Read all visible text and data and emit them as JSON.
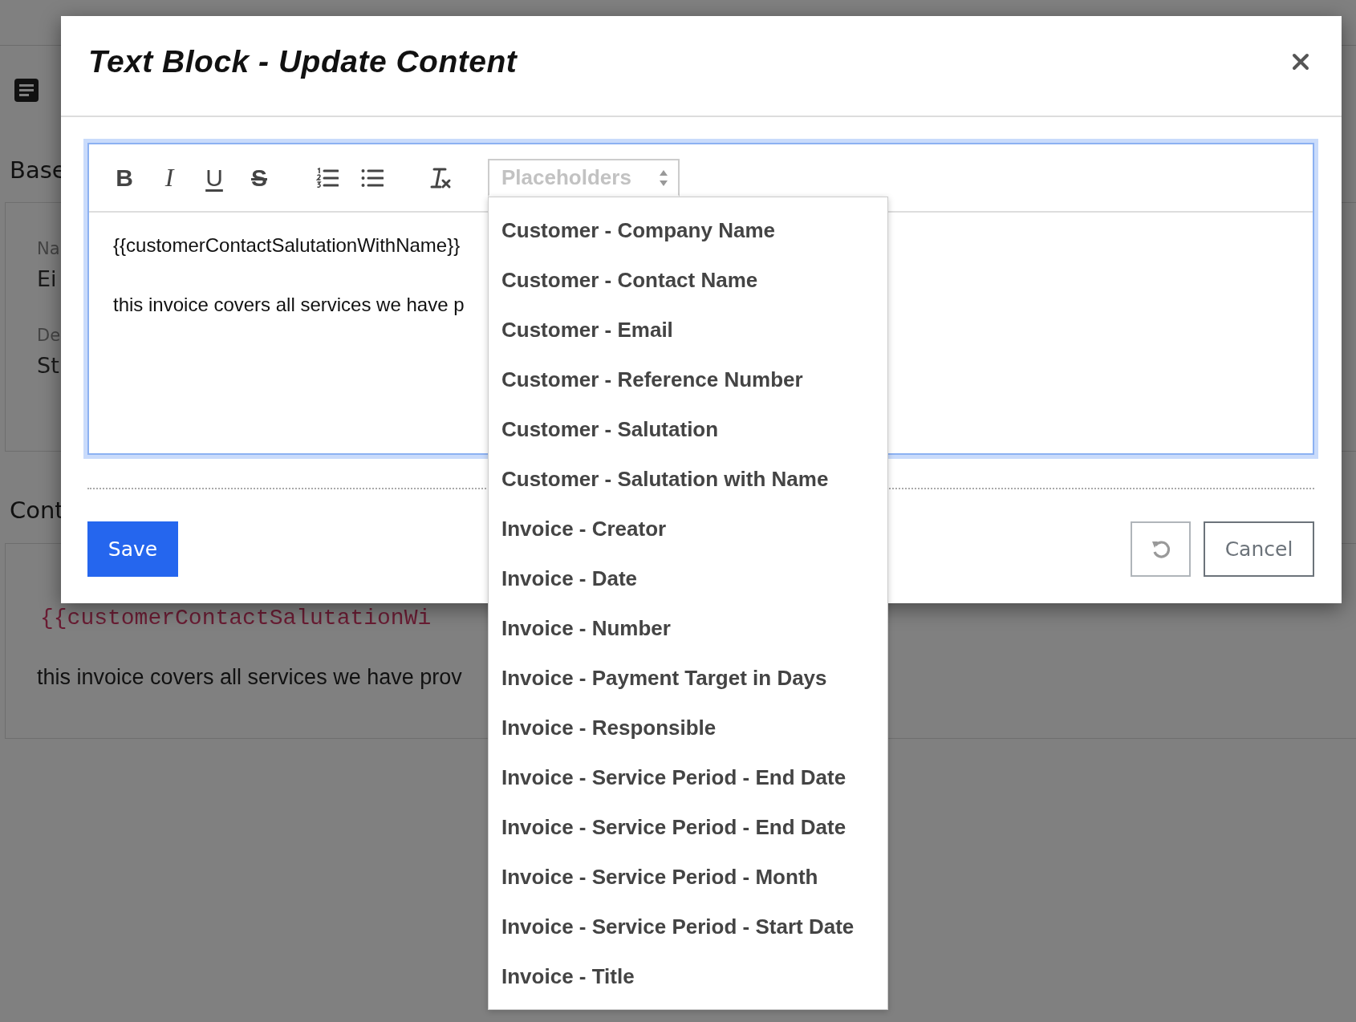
{
  "background": {
    "section_1_title": "Base",
    "fields": [
      {
        "label": "Na",
        "value": "Ei"
      },
      {
        "label": "De",
        "value": "St"
      }
    ],
    "section_2_title": "Cont",
    "content_lines": [
      {
        "kind": "code",
        "text": "{{customerContactSalutationWi"
      },
      {
        "kind": "text",
        "text": "this invoice covers all services we have prov"
      }
    ]
  },
  "dialog": {
    "title": "Text Block - Update Content",
    "toolbar": [
      {
        "buttons": [
          {
            "kind": "bold",
            "label": "B"
          },
          {
            "kind": "italic",
            "label": "I"
          },
          {
            "kind": "underline",
            "label": "U"
          },
          {
            "kind": "strike",
            "label": "S"
          }
        ]
      },
      {
        "buttons": [
          {
            "kind": "ordered-list"
          },
          {
            "kind": "bullet-list"
          }
        ]
      },
      {
        "buttons": [
          {
            "kind": "clear-format"
          }
        ]
      }
    ],
    "placeholder_select": {
      "placeholder": "Placeholders",
      "expanded": true,
      "options": [
        "Customer - Company Name",
        "Customer - Contact Name",
        "Customer - Email",
        "Customer - Reference Number",
        "Customer - Salutation",
        "Customer - Salutation with Name",
        "Invoice - Creator",
        "Invoice - Date",
        "Invoice - Number",
        "Invoice - Payment Target in Days",
        "Invoice - Responsible",
        "Invoice - Service Period - End Date",
        "Invoice - Service Period - End Date",
        "Invoice - Service Period - Month",
        "Invoice - Service Period - Start Date",
        "Invoice - Title"
      ]
    },
    "editor_lines": [
      "{{customerContactSalutationWithName}}",
      "this invoice covers all services we have p"
    ],
    "buttons": [
      {
        "kind": "primary",
        "label": "Save"
      },
      {
        "kind": "reset"
      },
      {
        "kind": "secondary",
        "label": "Cancel"
      }
    ]
  }
}
